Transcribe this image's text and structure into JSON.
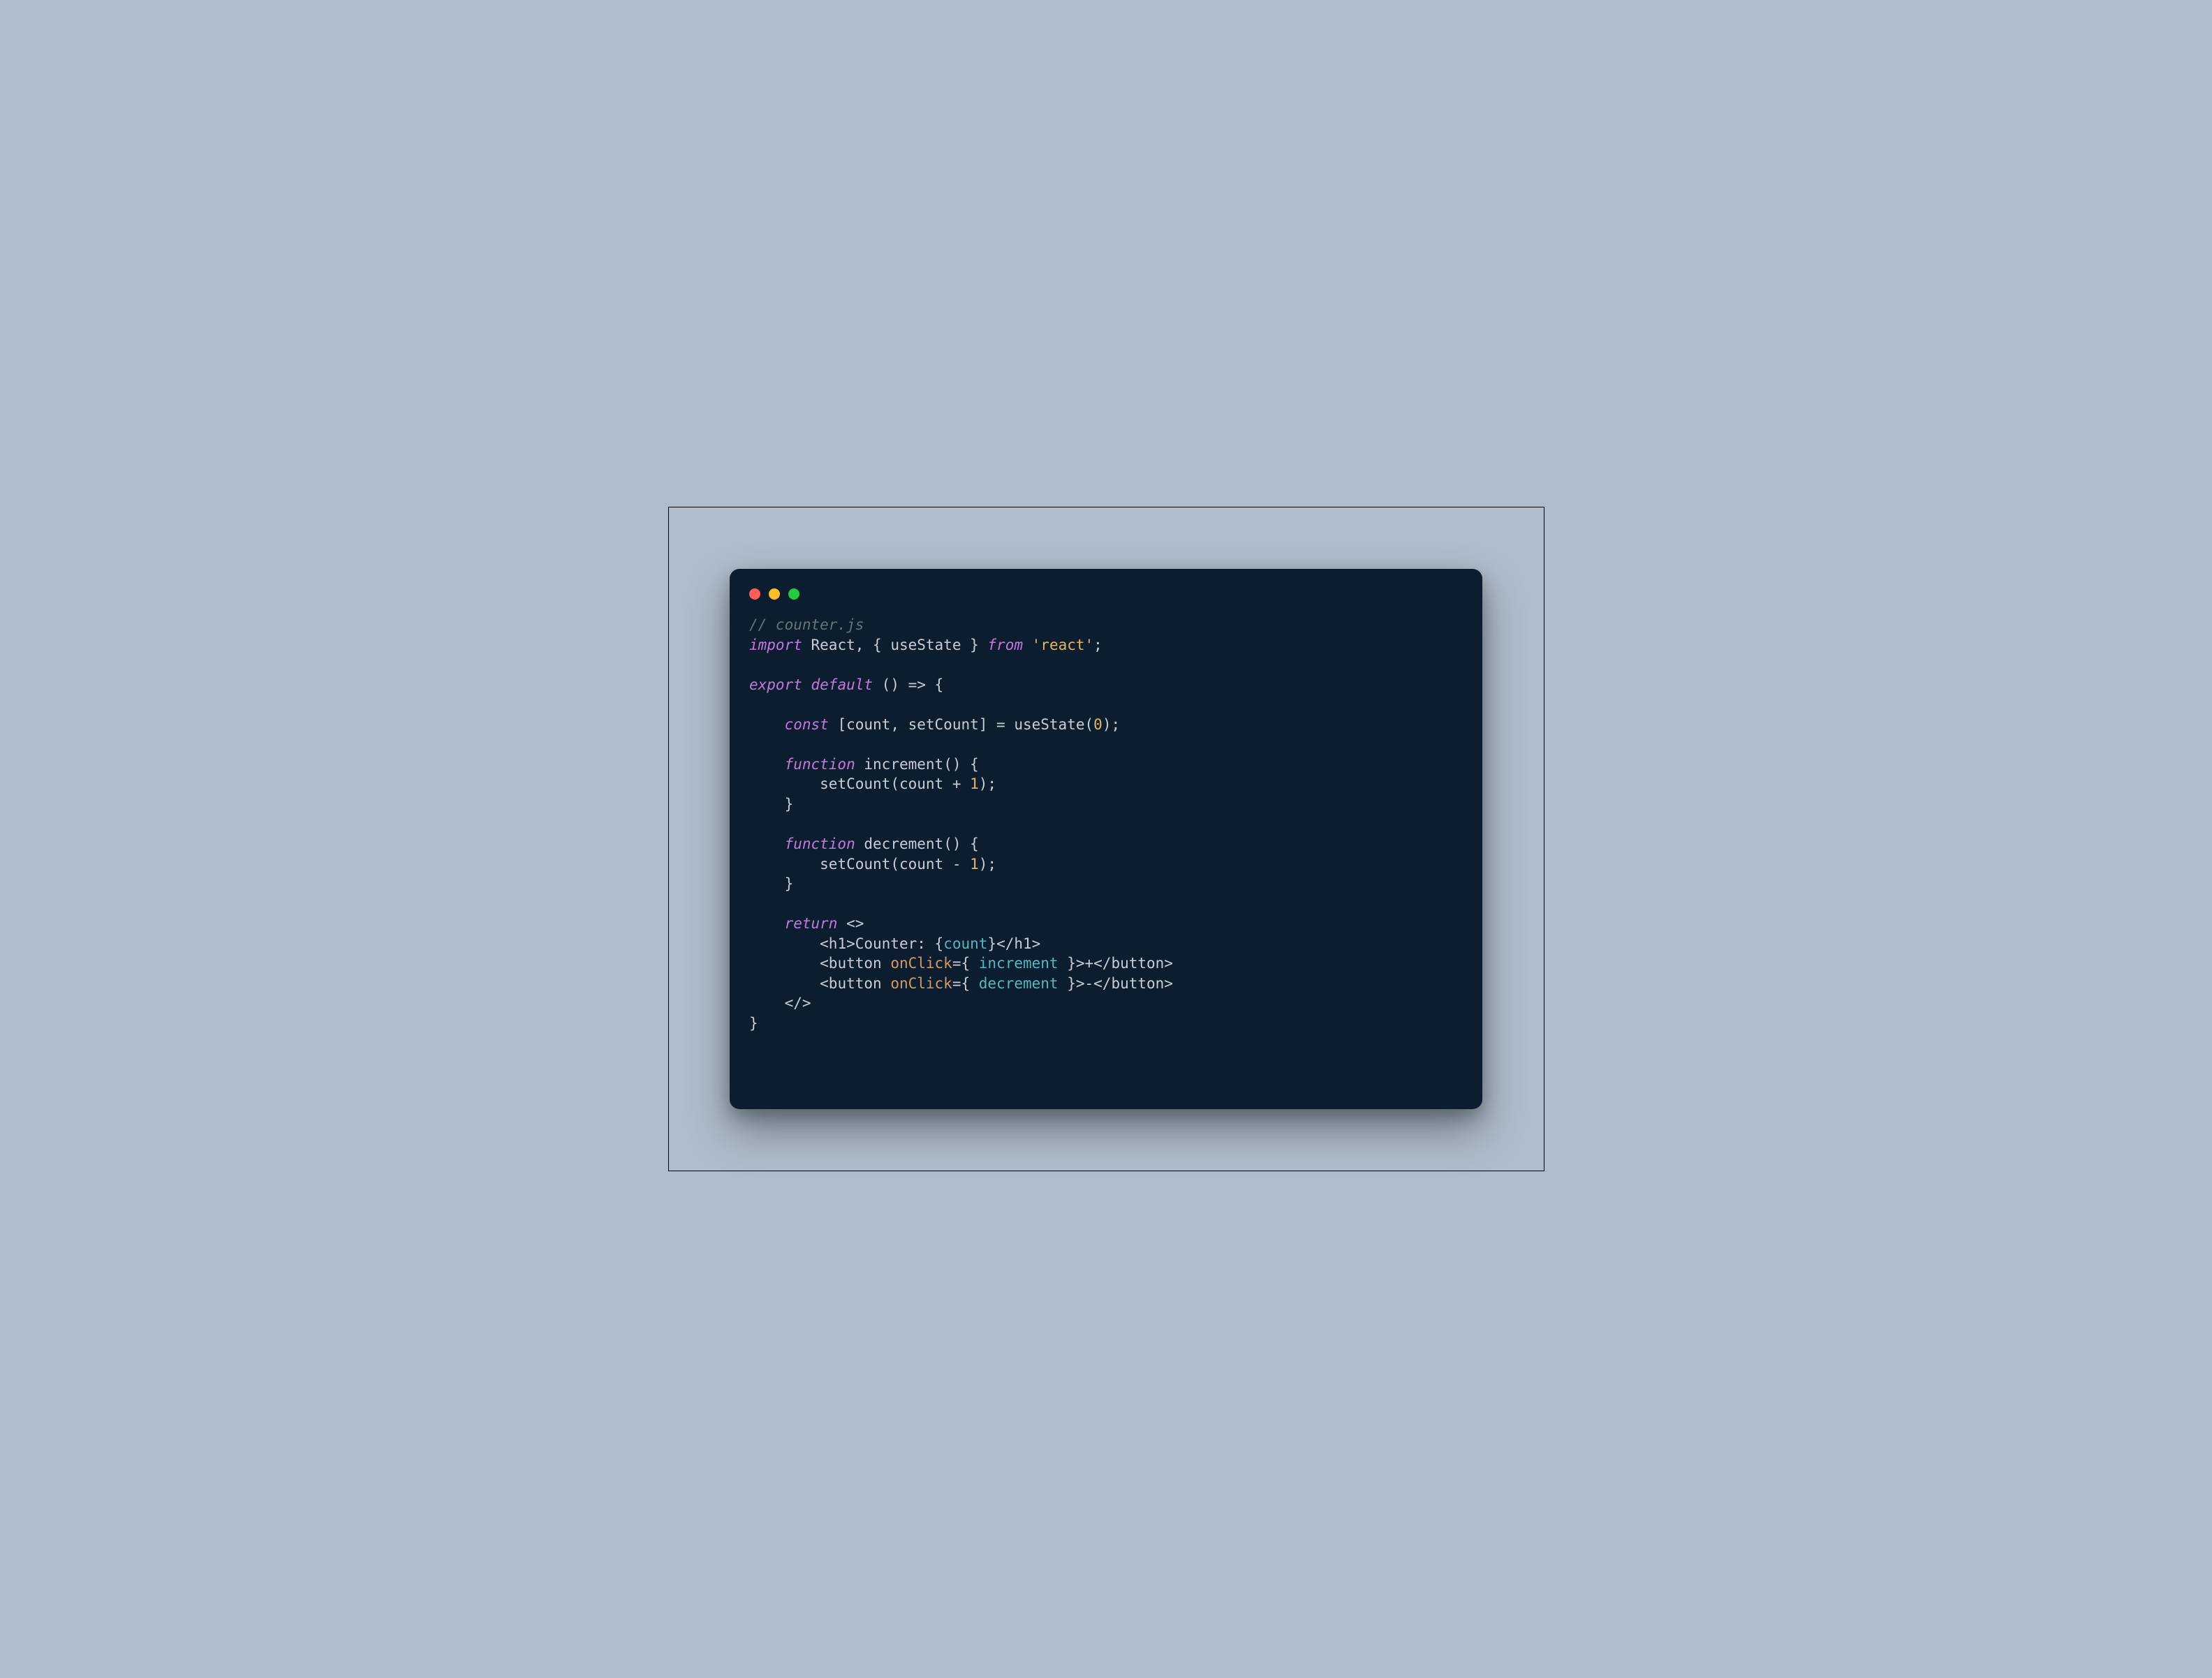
{
  "window": {
    "traffic_lights": {
      "close_color": "#ff5f56",
      "minimize_color": "#ffbd2e",
      "zoom_color": "#27c93f"
    }
  },
  "code": {
    "comment_file": "// counter.js",
    "kw_import": "import",
    "react_ident": "React",
    "comma_space": ", ",
    "brace_open": "{ ",
    "useState_ident": "useState",
    "brace_close": " } ",
    "kw_from": "from",
    "space": " ",
    "react_pkg": "'react'",
    "semicolon": ";",
    "kw_export": "export",
    "kw_default": "default",
    "arrow_open": " () => {",
    "indent1": "    ",
    "indent2": "        ",
    "kw_const": "const",
    "destruct_open": " [",
    "count_ident": "count",
    "setCount_ident": "setCount",
    "destruct_close": "] = ",
    "useState_call": "useState",
    "paren_open": "(",
    "zero": "0",
    "paren_close_semi": ");",
    "kw_function": "function",
    "increment_name": "increment",
    "fn_sig": "() {",
    "setCount_call": "setCount",
    "count_ref": "count",
    "plus_op": " + ",
    "one_a": "1",
    "close_call": ");",
    "brace_close_line": "}",
    "decrement_name": "decrement",
    "minus_op": " - ",
    "one_b": "1",
    "kw_return": "return",
    "frag_open": " <>",
    "h1_open": "<h1>",
    "counter_label": "Counter: ",
    "jsx_expr_open": "{",
    "jsx_expr_close": "}",
    "h1_close": "</h1>",
    "btn_open": "<button ",
    "onclick_attr": "onClick",
    "eq_brace": "={ ",
    "inc_ref": "increment",
    "dec_ref": "decrement",
    "brace_gt": " }>",
    "plus_text": "+",
    "minus_text": "-",
    "btn_close": "</button>",
    "frag_close": "</>",
    "final_brace": "}"
  }
}
